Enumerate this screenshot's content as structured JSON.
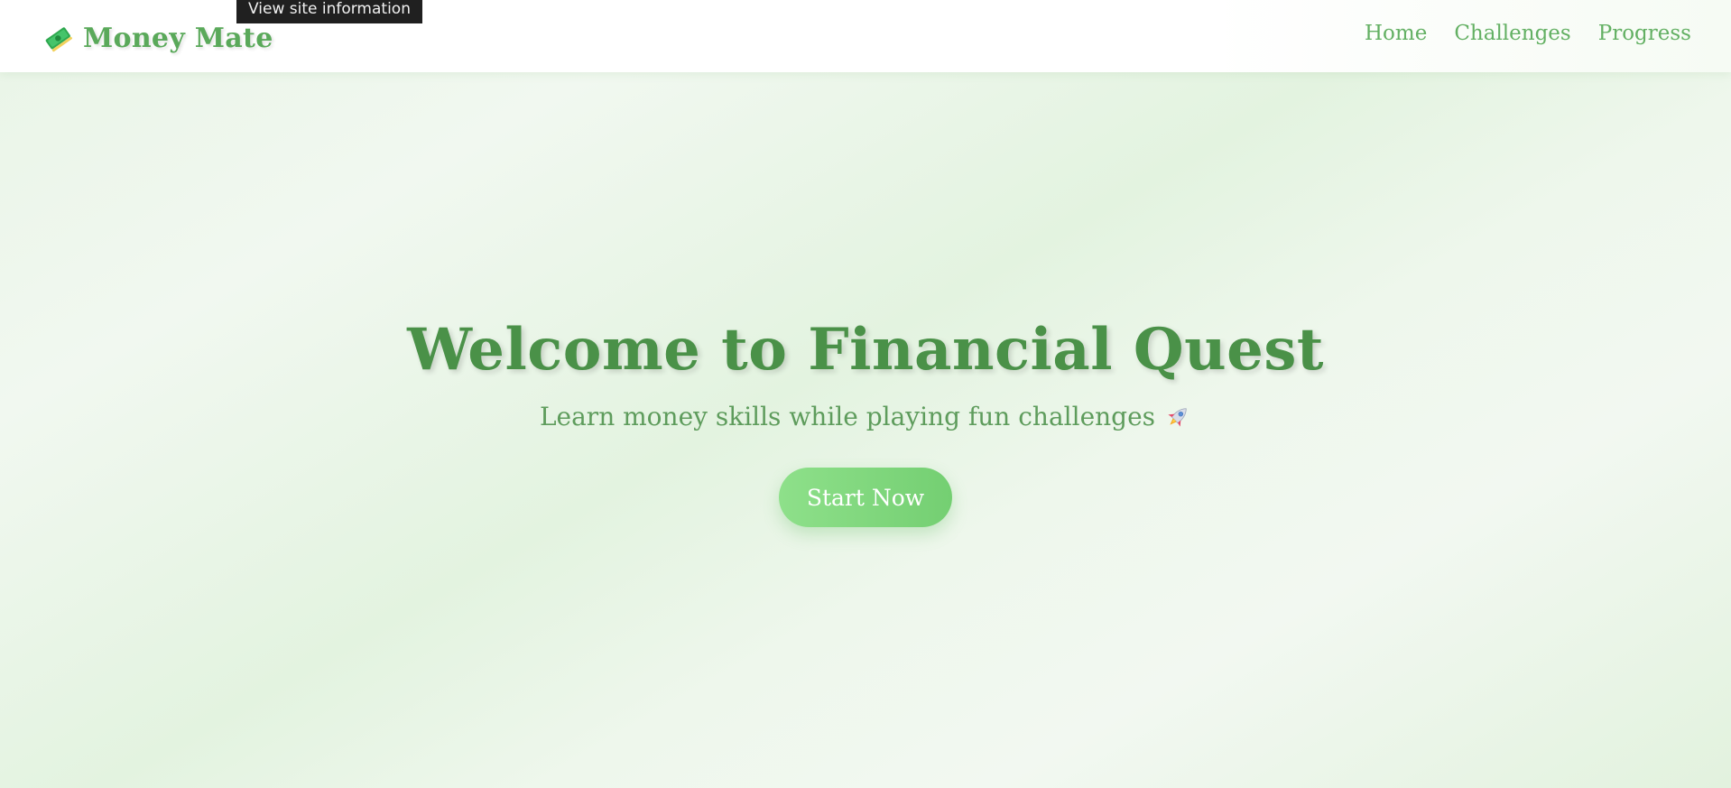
{
  "tooltip": {
    "text": "View site information"
  },
  "header": {
    "brand": {
      "icon": "money-bill-icon",
      "name": "Money Mate"
    },
    "nav": [
      {
        "label": "Home"
      },
      {
        "label": "Challenges"
      },
      {
        "label": "Progress"
      }
    ]
  },
  "hero": {
    "title": "Welcome to Financial Quest",
    "subtitle": "Learn money skills while playing fun challenges",
    "subtitle_icon": "rocket-icon",
    "cta_label": "Start Now"
  },
  "colors": {
    "brand_green": "#5aa95a",
    "title_green": "#4a9148",
    "nav_green": "#63b063",
    "button_green_start": "#8ee08a",
    "button_green_end": "#74cf72",
    "hero_background": "#e8f5e5"
  }
}
